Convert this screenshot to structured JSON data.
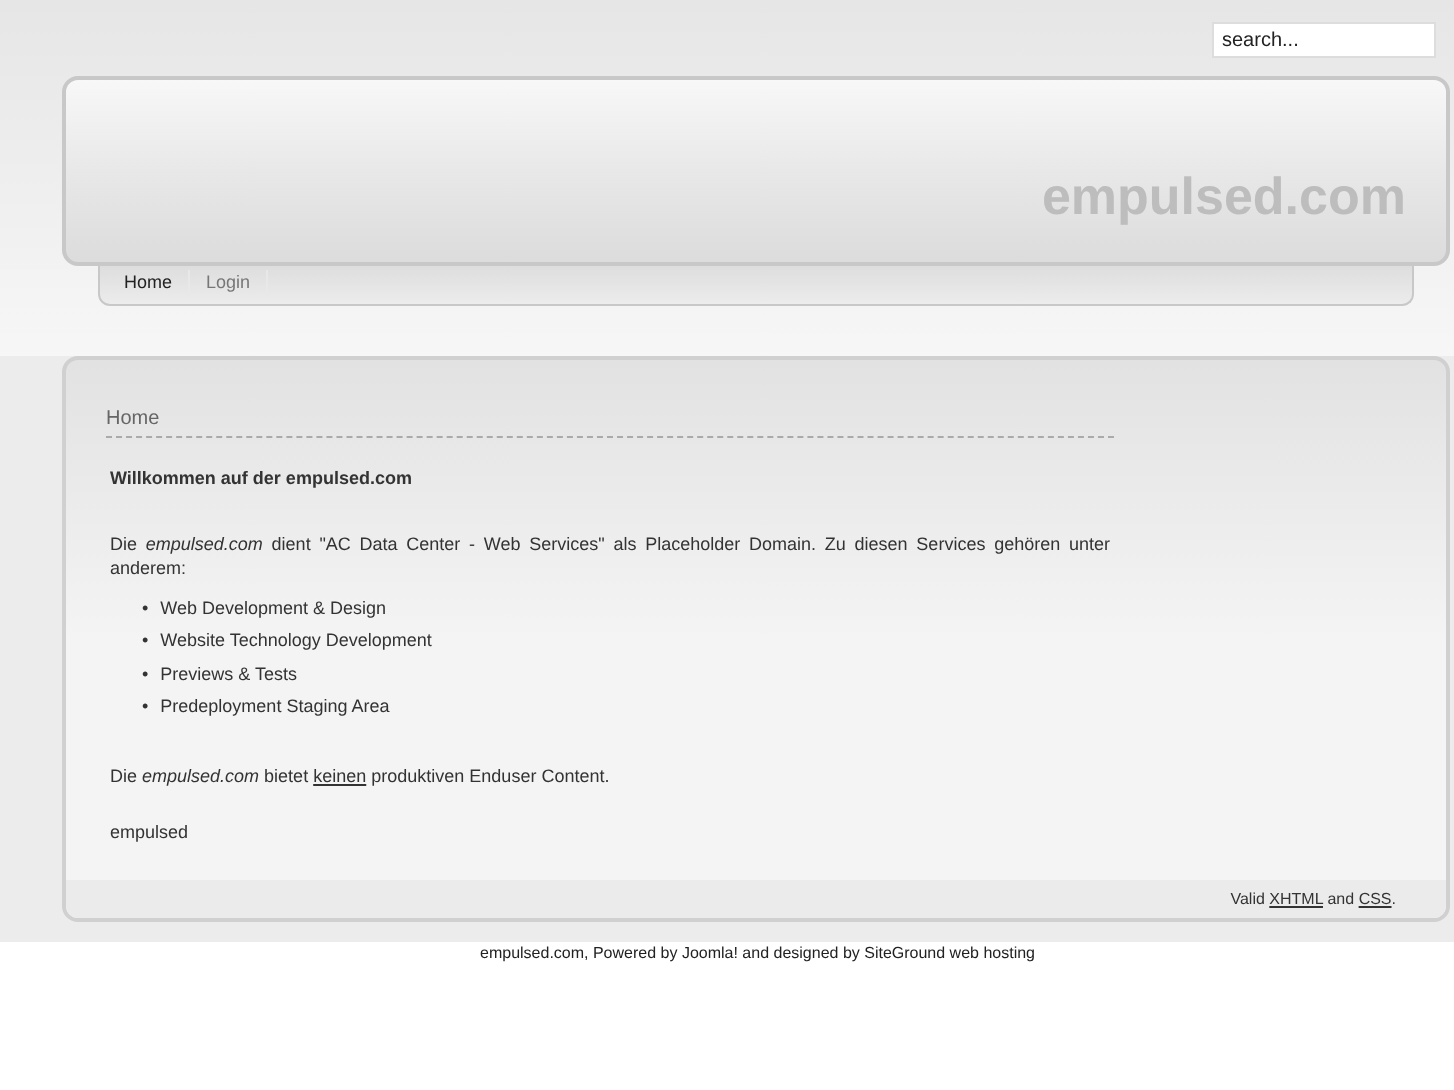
{
  "search": {
    "placeholder": "search..."
  },
  "header": {
    "site_title": "empulsed.com"
  },
  "nav": [
    {
      "label": "Home",
      "selected": true
    },
    {
      "label": "Login",
      "selected": false
    }
  ],
  "breadcrumb": "Home",
  "article": {
    "heading": "Willkommen auf der empulsed.com",
    "intro": "Die *empulsed.com* dient  \"AC Data Center - Web Services\"  als Placeholder Domain. Zu diesen Services gehören unter anderem:",
    "bullet": "•",
    "list": [
      "Web Development & Design",
      "Website Technology Development",
      "Previews & Tests",
      "Predeployment Staging Area"
    ],
    "note": [
      {
        "kind": "text",
        "text": "Die *empulsed.com* bietet"
      },
      {
        "kind": "link",
        "text": "keinen"
      },
      {
        "kind": "text",
        "text": "produktiven Enduser Content."
      }
    ],
    "signature": "empulsed"
  },
  "validity": [
    {
      "kind": "text",
      "text": "Valid"
    },
    {
      "kind": "link",
      "text": "XHTML"
    },
    {
      "kind": "text",
      "text": "and"
    },
    {
      "kind": "link",
      "text": "CSS"
    },
    {
      "kind": "text",
      "text": "."
    }
  ],
  "credits": "empulsed.com, Powered by Joomla! and designed by SiteGround web hosting"
}
